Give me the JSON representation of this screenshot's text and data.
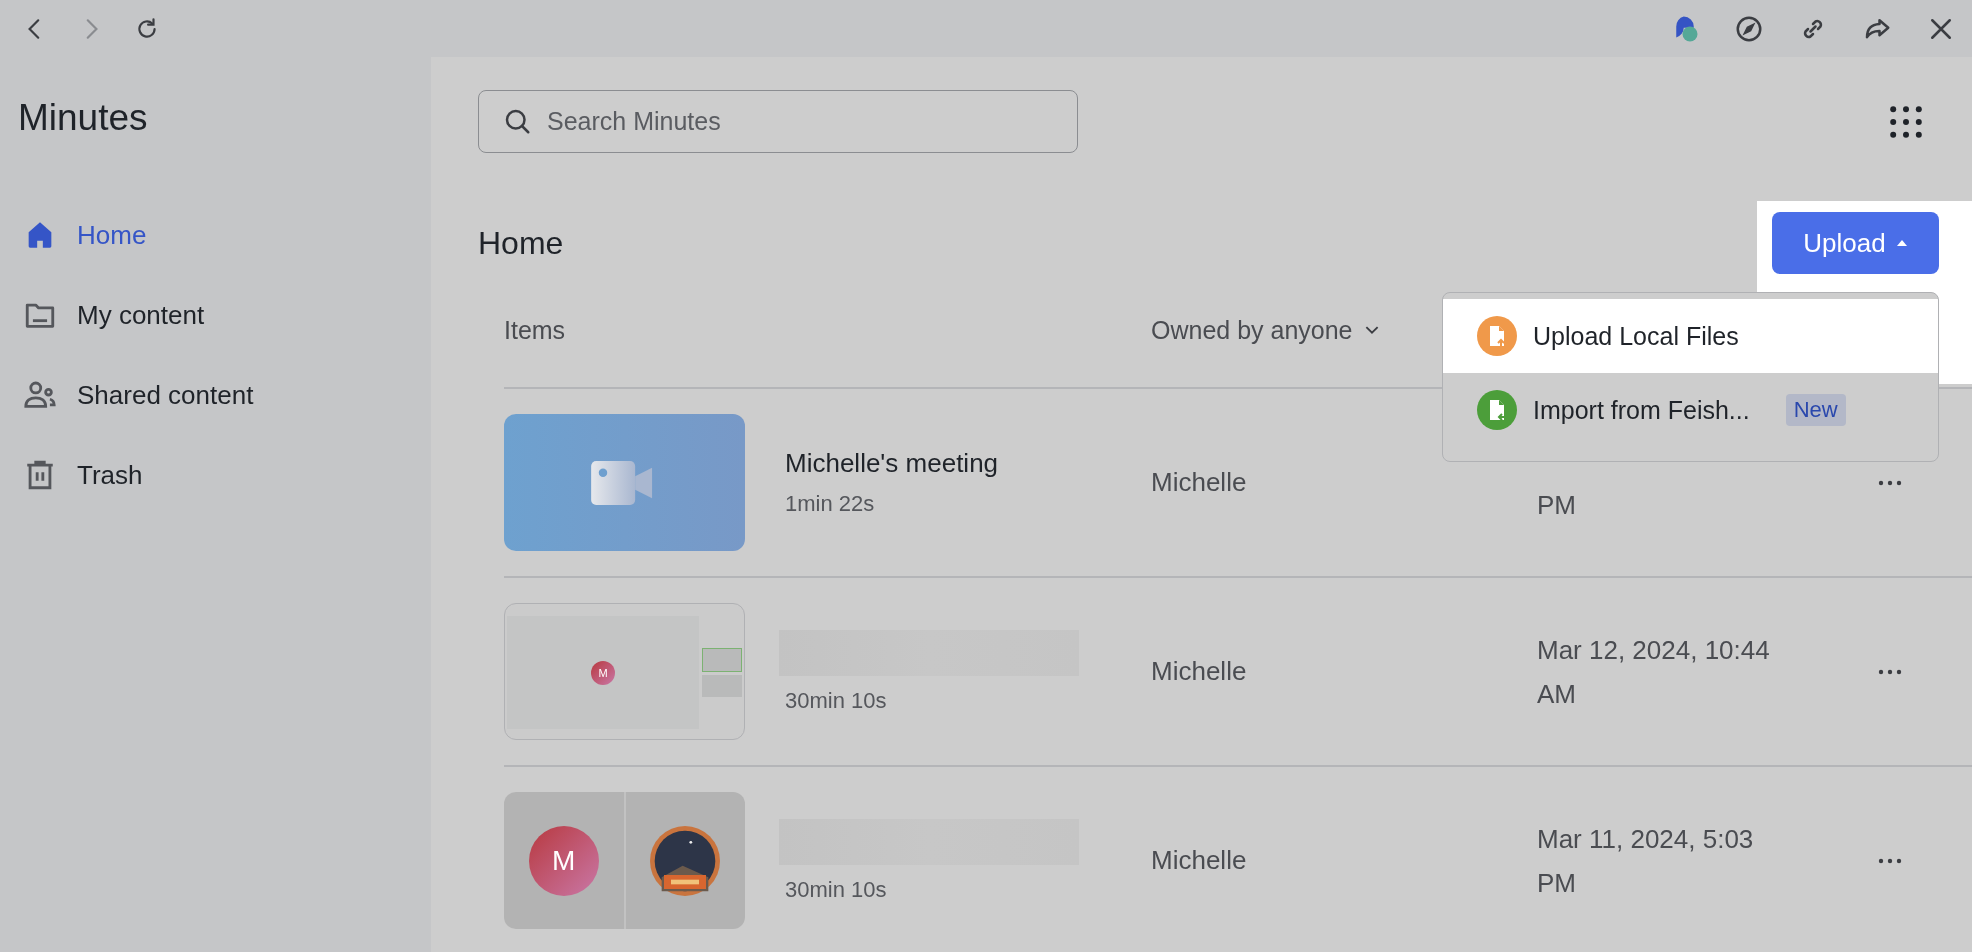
{
  "toolbar": {
    "nav_buttons": [
      {
        "kind": "back",
        "disabled": false
      },
      {
        "kind": "forward",
        "disabled": true
      },
      {
        "kind": "reload",
        "disabled": false
      }
    ],
    "actions": [
      {
        "kind": "chat"
      },
      {
        "kind": "compass"
      },
      {
        "kind": "link"
      },
      {
        "kind": "share"
      },
      {
        "kind": "close"
      }
    ]
  },
  "sidebar": {
    "title": "Minutes",
    "items": [
      {
        "label": "Home",
        "kind": "home",
        "selected": true
      },
      {
        "label": "My content",
        "kind": "folder",
        "selected": false
      },
      {
        "label": "Shared content",
        "kind": "people",
        "selected": false
      },
      {
        "label": "Trash",
        "kind": "trash",
        "selected": false
      }
    ]
  },
  "search": {
    "placeholder": "Search Minutes"
  },
  "page_title": "Home",
  "upload_button": {
    "label": "Upload",
    "expanded": true
  },
  "upload_menu": {
    "items": [
      {
        "label": "Upload Local Files",
        "kind": "upload",
        "color": "#f0994a",
        "highlighted": true
      },
      {
        "label": "Import from Feish...",
        "kind": "import",
        "color": "#4c9e3a",
        "badge": "New",
        "highlighted": false
      }
    ]
  },
  "table": {
    "columns": [
      "Items",
      "Owned by anyone"
    ],
    "rows": [
      {
        "kind": "camera",
        "title": "Michelle's meeting",
        "duration": "1min 22s",
        "owner": "Michelle",
        "date": [
          "PM"
        ]
      },
      {
        "kind": "screen",
        "title_blurred": true,
        "avatar": "M",
        "duration": "30min 10s",
        "owner": "Michelle",
        "date": [
          "Mar 12, 2024, 10:44",
          "AM"
        ]
      },
      {
        "kind": "split",
        "title_blurred": true,
        "avatar": "M",
        "duration": "30min 10s",
        "owner": "Michelle",
        "date": [
          "Mar 11, 2024, 5:03",
          "PM"
        ]
      }
    ]
  }
}
